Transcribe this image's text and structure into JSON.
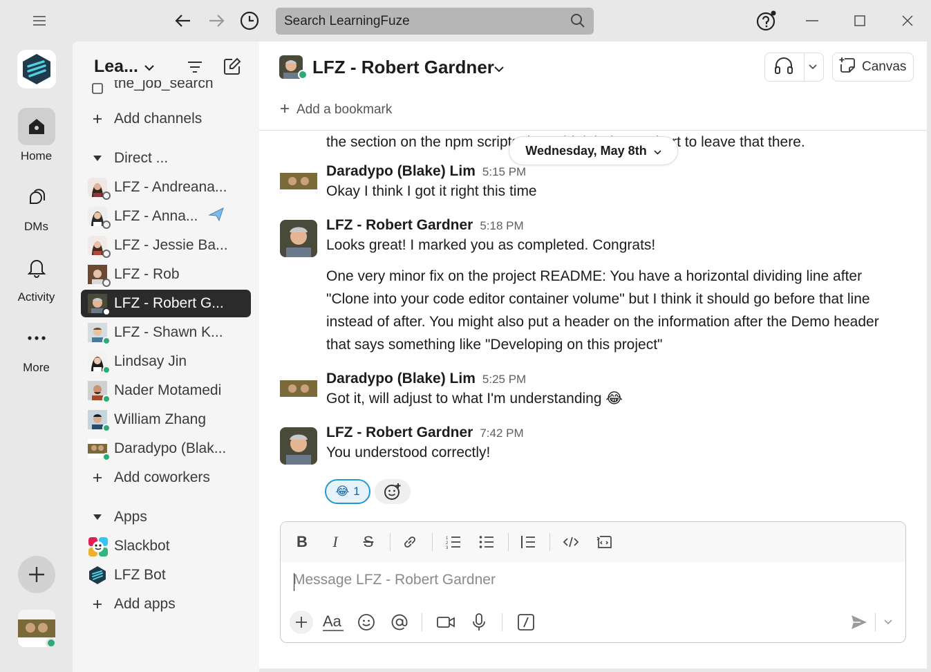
{
  "search": {
    "placeholder": "Search LearningFuze"
  },
  "rail": {
    "items": [
      {
        "label": "Home"
      },
      {
        "label": "DMs"
      },
      {
        "label": "Activity"
      },
      {
        "label": "More"
      }
    ]
  },
  "sidebar": {
    "workspace_name": "Lea...",
    "partial_channel": "the_job_search",
    "add_channels": "Add channels",
    "direct_header": "Direct ...",
    "dms": [
      {
        "label": "LFZ - Andreana..."
      },
      {
        "label": "LFZ - Anna..."
      },
      {
        "label": "LFZ - Jessie Ba..."
      },
      {
        "label": "LFZ - Rob"
      },
      {
        "label": "LFZ - Robert G..."
      },
      {
        "label": "LFZ - Shawn K..."
      },
      {
        "label": "Lindsay Jin"
      },
      {
        "label": "Nader Motamedi"
      },
      {
        "label": "William Zhang"
      },
      {
        "label": "Daradypo (Blak..."
      }
    ],
    "add_coworkers": "Add coworkers",
    "apps_header": "Apps",
    "apps": [
      {
        "label": "Slackbot"
      },
      {
        "label": "LFZ Bot"
      }
    ],
    "add_apps": "Add apps"
  },
  "channel": {
    "title": "LFZ - Robert Gardner",
    "canvas_label": "Canvas",
    "bookmark_label": "Add a bookmark"
  },
  "date_divider": "Wednesday, May 8th",
  "messages": {
    "partial": "the section on the npm scripts, but I think it doesn't hurt to leave that there.",
    "m1": {
      "author": "Daradypo (Blake) Lim",
      "time": "5:15 PM",
      "text": "Okay I think I got it right this time"
    },
    "m2": {
      "author": "LFZ - Robert Gardner",
      "time": "5:18 PM",
      "text": "Looks great! I marked you as completed. Congrats!",
      "text2": "One very minor fix on the project README: You have a horizontal dividing line after \"Clone into your code editor container volume\" but I think it should go before that line instead of after. You might also put a header on the information after the Demo header that says something like \"Developing on this project\""
    },
    "m3": {
      "author": "Daradypo (Blake) Lim",
      "time": "5:25 PM",
      "text": "Got it, will adjust to what I'm understanding 😂"
    },
    "m4": {
      "author": "LFZ - Robert Gardner",
      "time": "7:42 PM",
      "text": "You understood correctly!",
      "reaction_emoji": "😂",
      "reaction_count": "1"
    }
  },
  "composer": {
    "placeholder": "Message LFZ - Robert Gardner"
  },
  "colors": {
    "presence_online": "#2bac76",
    "active_row": "#2b2b2b",
    "accent_blue": "#1264a3"
  }
}
